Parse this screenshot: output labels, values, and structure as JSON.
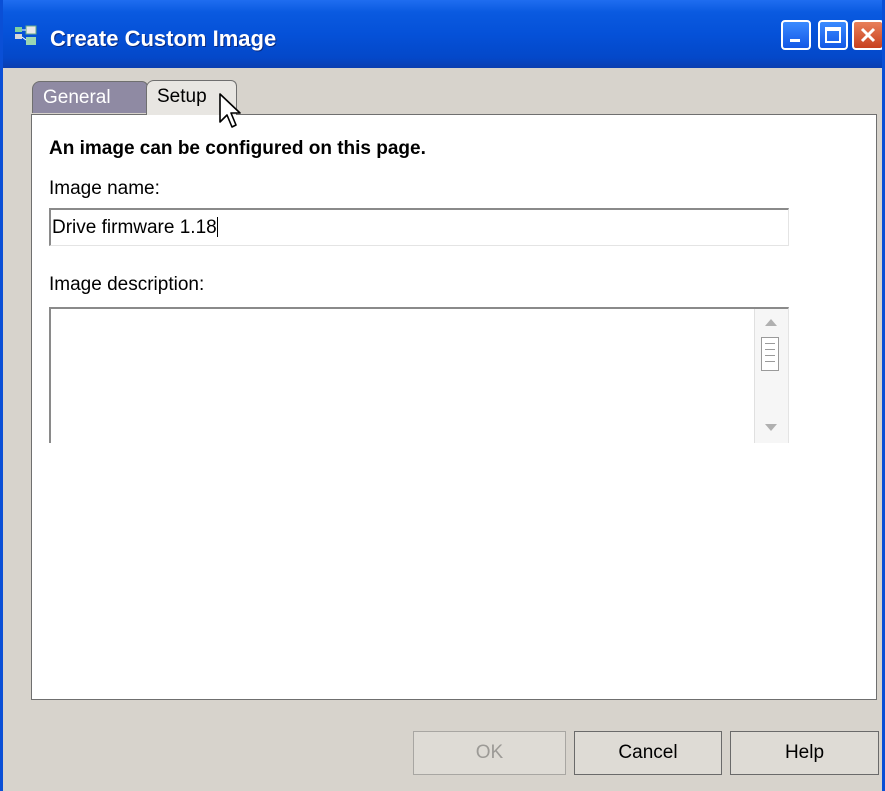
{
  "window": {
    "title": "Create Custom Image"
  },
  "tabs": [
    {
      "label": "General"
    },
    {
      "label": "Setup"
    }
  ],
  "panel": {
    "heading": "An image can be configured on this page.",
    "image_name_label": "Image name:",
    "image_name_value": "Drive firmware 1.18",
    "image_description_label": "Image description:",
    "image_description_value": ""
  },
  "buttons": {
    "ok": "OK",
    "cancel": "Cancel",
    "help": "Help"
  },
  "colors": {
    "titlebar": "#0551d8",
    "tab_active": "#8f8aa3",
    "window_bg": "#d7d3cc"
  }
}
